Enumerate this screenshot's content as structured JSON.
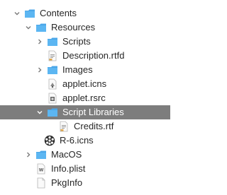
{
  "tree": {
    "rows": [
      {
        "label": "Contents",
        "icon": "folder-icon",
        "expanded": true
      },
      {
        "label": "Resources",
        "icon": "folder-icon",
        "expanded": true
      },
      {
        "label": "Scripts",
        "icon": "folder-icon",
        "expanded": false
      },
      {
        "label": "Description.rtfd",
        "icon": "rtfd-document-icon"
      },
      {
        "label": "Images",
        "icon": "folder-icon",
        "expanded": false
      },
      {
        "label": "applet.icns",
        "icon": "icns-file-icon"
      },
      {
        "label": "applet.rsrc",
        "icon": "rsrc-file-icon"
      },
      {
        "label": "Script Libraries",
        "icon": "folder-icon",
        "expanded": true,
        "selected": true
      },
      {
        "label": "Credits.rtf",
        "icon": "rtf-document-icon"
      },
      {
        "label": "R-6.icns",
        "icon": "film-reel-icon"
      },
      {
        "label": "MacOS",
        "icon": "folder-icon",
        "expanded": false
      },
      {
        "label": "Info.plist",
        "icon": "plist-file-icon"
      },
      {
        "label": "PkgInfo",
        "icon": "generic-file-icon"
      }
    ]
  },
  "colors": {
    "folder": "#4aa6e8",
    "selection": "#7d7d7d",
    "text": "#262626"
  }
}
